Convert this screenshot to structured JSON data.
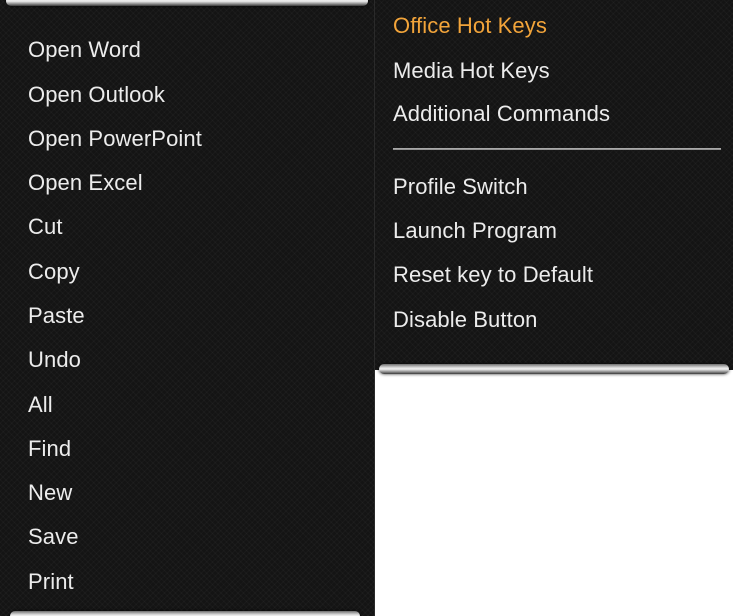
{
  "left_menu": {
    "items": [
      {
        "label": "Open Word"
      },
      {
        "label": "Open Outlook"
      },
      {
        "label": "Open PowerPoint"
      },
      {
        "label": "Open Excel"
      },
      {
        "label": "Cut"
      },
      {
        "label": "Copy"
      },
      {
        "label": "Paste"
      },
      {
        "label": "Undo"
      },
      {
        "label": "All"
      },
      {
        "label": "Find"
      },
      {
        "label": "New"
      },
      {
        "label": "Save"
      },
      {
        "label": "Print"
      }
    ]
  },
  "right_menu": {
    "groups": [
      {
        "label": "Office Hot Keys",
        "active": true
      },
      {
        "label": "Media Hot Keys"
      },
      {
        "label": "Additional Commands"
      }
    ],
    "actions": [
      {
        "label": "Profile Switch"
      },
      {
        "label": "Launch Program"
      },
      {
        "label": "Reset key to Default"
      },
      {
        "label": "Disable Button"
      }
    ]
  },
  "colors": {
    "panel_background": "#141414",
    "text": "#ececec",
    "active_text": "#f2a43a"
  }
}
